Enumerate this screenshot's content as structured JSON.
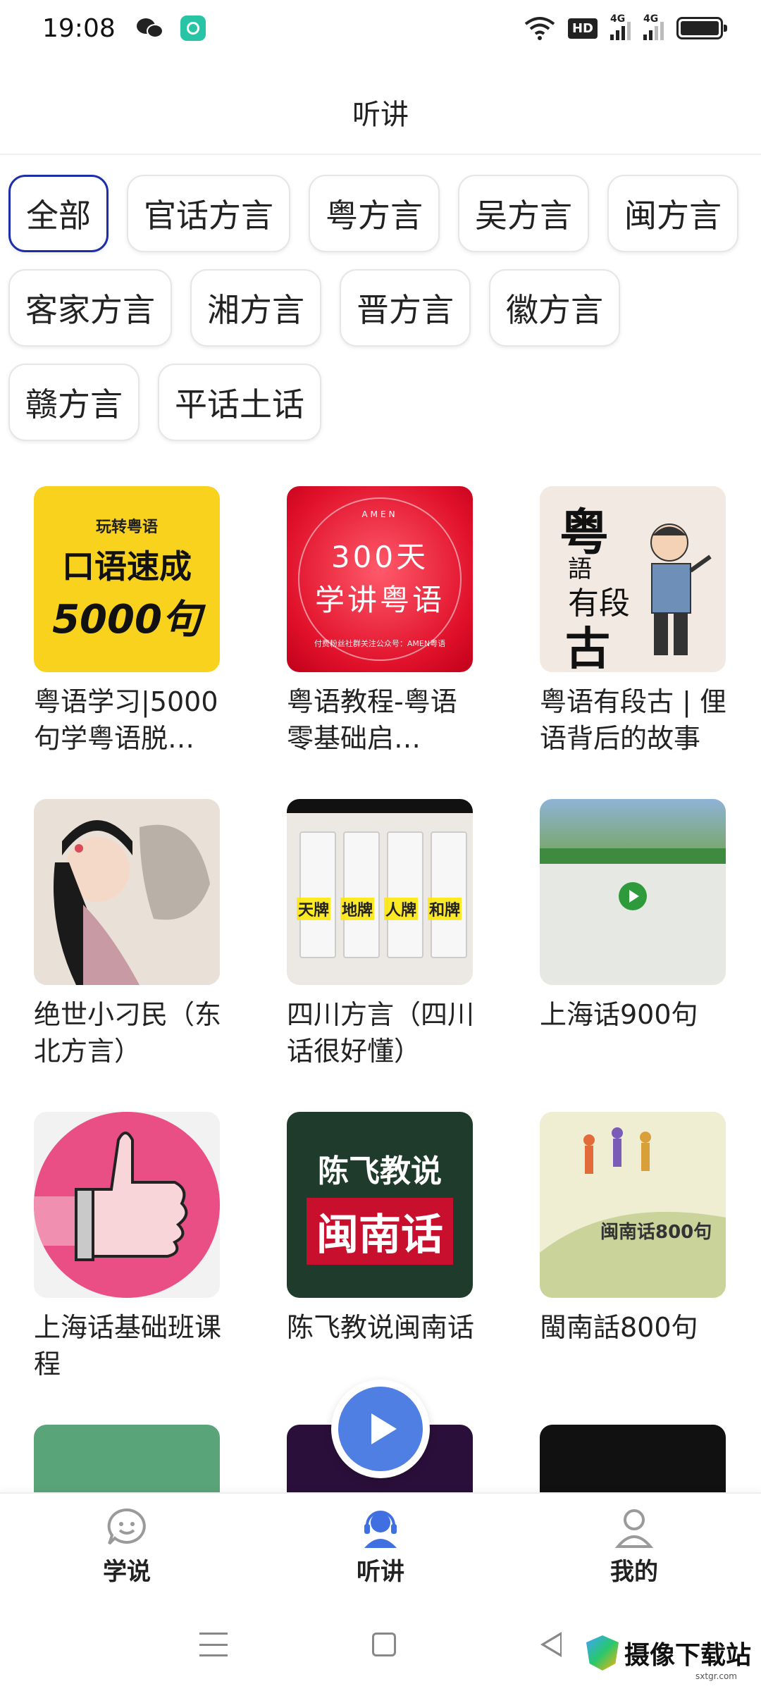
{
  "status_bar": {
    "time": "19:08",
    "hd": "HD",
    "net1": "4G",
    "net2": "4G"
  },
  "header": {
    "title": "听讲"
  },
  "categories": [
    {
      "label": "全部",
      "active": true
    },
    {
      "label": "官话方言"
    },
    {
      "label": "粤方言"
    },
    {
      "label": "吴方言"
    },
    {
      "label": "闽方言"
    },
    {
      "label": "客家方言"
    },
    {
      "label": "湘方言"
    },
    {
      "label": "晋方言"
    },
    {
      "label": "徽方言"
    },
    {
      "label": "赣方言"
    },
    {
      "label": "平话土话"
    }
  ],
  "albums": [
    {
      "title": "粤语学习|5000句学粤语脱…",
      "cover": {
        "small": "玩转粤语",
        "mid": "口语速成",
        "big": "5000句"
      }
    },
    {
      "title": "粤语教程-粤语零基础启…",
      "cover": {
        "brand": "AMEN",
        "line1": "300天",
        "line2": "学讲粤语",
        "foot": "付费粉丝社群关注公众号：AMEN粤语"
      }
    },
    {
      "title": "粤语有段古 | 俚语背后的故事",
      "cover": {
        "c1": "粤",
        "c2": "語",
        "c3": "有段",
        "c4": "古"
      }
    },
    {
      "title": "绝世小刁民（东北方言）"
    },
    {
      "title": "四川方言（四川话很好懂）",
      "cover": {
        "t1": "天牌",
        "t2": "地牌",
        "t3": "人牌",
        "t4": "和牌"
      }
    },
    {
      "title": "上海话900句"
    },
    {
      "title": "上海话基础班课程"
    },
    {
      "title": "陈飞教说闽南话",
      "cover": {
        "line1": "陈飞教说",
        "line2": "闽南话"
      }
    },
    {
      "title": "閩南話800句",
      "cover": {
        "label": "闽南话800句"
      }
    }
  ],
  "tabs": [
    {
      "label": "学说",
      "icon": "chat-face-icon"
    },
    {
      "label": "听讲",
      "icon": "headset-user-icon",
      "active": true
    },
    {
      "label": "我的",
      "icon": "user-icon"
    }
  ],
  "watermark": {
    "text": "摄像下载站",
    "sub": "sxtgr.com"
  },
  "colors": {
    "accent": "#4f7fe3",
    "active_chip_border": "#1c2fa8"
  }
}
